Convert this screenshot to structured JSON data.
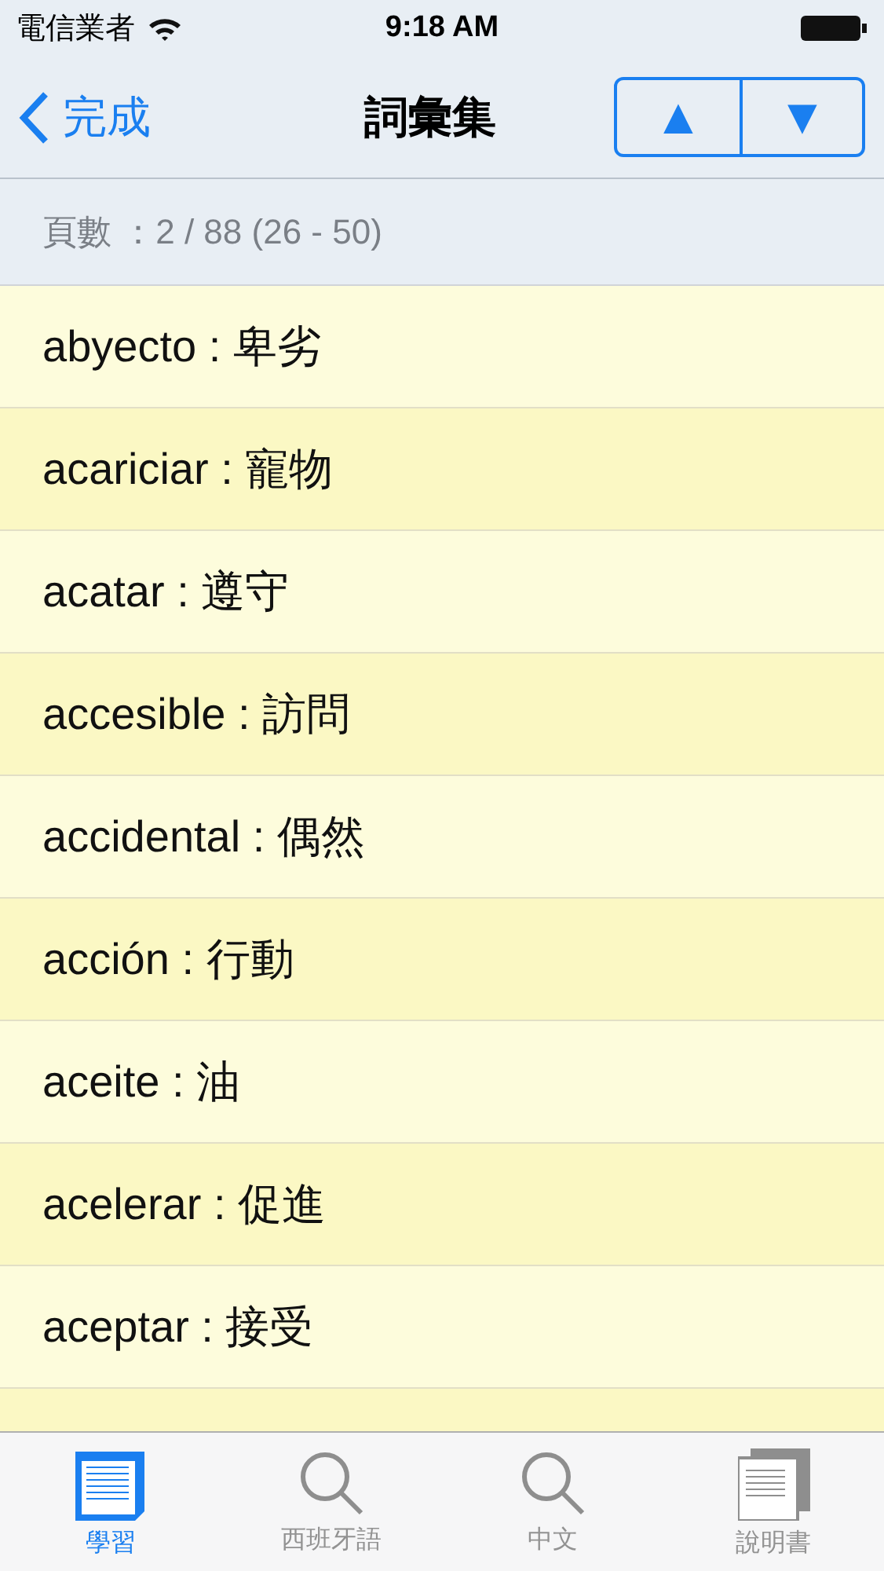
{
  "status_bar": {
    "carrier": "電信業者",
    "time": "9:18 AM"
  },
  "nav": {
    "back": "完成",
    "title": "詞彙集",
    "buttons": [
      "▲",
      "▼"
    ]
  },
  "page_info": "頁數 ：2 / 88 (26 - 50)",
  "words": [
    {
      "term": "abyecto : 卑劣"
    },
    {
      "term": "acariciar : 寵物"
    },
    {
      "term": "acatar : 遵守"
    },
    {
      "term": "accesible : 訪問"
    },
    {
      "term": "accidental : 偶然"
    },
    {
      "term": "acción : 行動"
    },
    {
      "term": "aceite : 油"
    },
    {
      "term": "acelerar : 促進"
    },
    {
      "term": "aceptar : 接受"
    }
  ],
  "tabs": [
    {
      "label": "學習",
      "kind": "book",
      "selected": true
    },
    {
      "label": "西班牙語",
      "kind": "search",
      "selected": false
    },
    {
      "label": "中文",
      "kind": "search",
      "selected": false
    },
    {
      "label": "說明書",
      "kind": "pages",
      "selected": false
    }
  ]
}
